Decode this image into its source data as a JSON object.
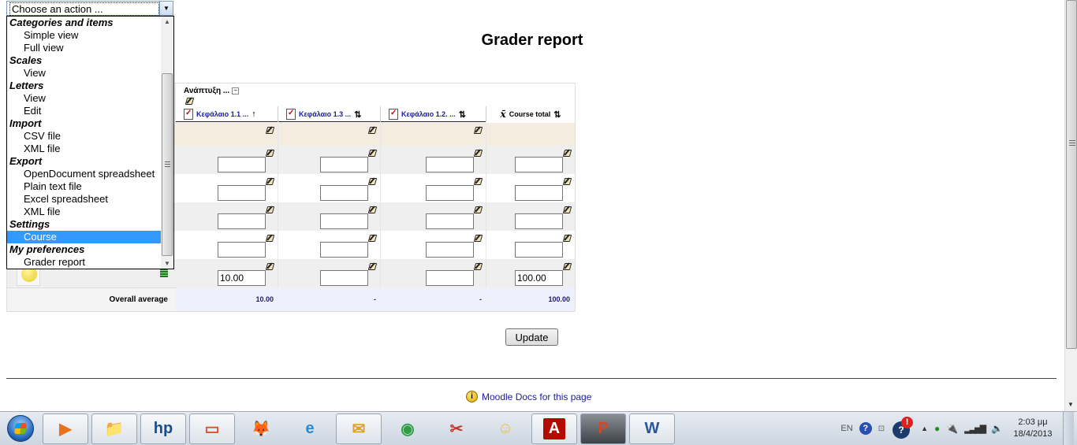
{
  "page": {
    "title": "Grader report",
    "update_label": "Update",
    "docs_link": "Moodle Docs for this page"
  },
  "action_select": {
    "value": "Choose an action ...",
    "options": [
      {
        "type": "group",
        "label": "Categories and items"
      },
      {
        "type": "option",
        "label": "Simple view"
      },
      {
        "type": "option",
        "label": "Full view"
      },
      {
        "type": "group",
        "label": "Scales"
      },
      {
        "type": "option",
        "label": "View"
      },
      {
        "type": "group",
        "label": "Letters"
      },
      {
        "type": "option",
        "label": "View"
      },
      {
        "type": "option",
        "label": "Edit"
      },
      {
        "type": "group",
        "label": "Import"
      },
      {
        "type": "option",
        "label": "CSV file"
      },
      {
        "type": "option",
        "label": "XML file"
      },
      {
        "type": "group",
        "label": "Export"
      },
      {
        "type": "option",
        "label": "OpenDocument spreadsheet"
      },
      {
        "type": "option",
        "label": "Plain text file"
      },
      {
        "type": "option",
        "label": "Excel spreadsheet"
      },
      {
        "type": "option",
        "label": "XML file"
      },
      {
        "type": "group",
        "label": "Settings"
      },
      {
        "type": "option",
        "label": "Course",
        "selected": true
      },
      {
        "type": "group",
        "label": "My preferences"
      },
      {
        "type": "option",
        "label": "Grader report"
      }
    ]
  },
  "grader": {
    "category_label": "Ανάπτυξη ...",
    "collapse_symbol": "−",
    "columns": [
      {
        "label": "Κεφάλαιο 1.1 ...",
        "sort": "↑",
        "icon": "assignment-icon"
      },
      {
        "label": "Κεφάλαιο 1.3 ...",
        "sort": "⇅",
        "icon": "assignment-icon"
      },
      {
        "label": "Κεφάλαιο 1.2. ...",
        "sort": "⇅",
        "icon": "assignment-icon"
      },
      {
        "label": "Course total",
        "sort": "⇅",
        "icon": "mean-icon"
      }
    ],
    "mean_symbol": "x̄",
    "rows": [
      {
        "values": [
          "",
          "",
          "",
          ""
        ]
      },
      {
        "values": [
          "",
          "",
          "",
          ""
        ]
      },
      {
        "values": [
          "",
          "",
          "",
          ""
        ]
      },
      {
        "values": [
          "",
          "",
          "",
          ""
        ]
      },
      {
        "values": [
          "10.00",
          "",
          "",
          "100.00"
        ]
      }
    ],
    "overall_average": {
      "label": "Overall average",
      "values": [
        "10.00",
        "-",
        "-",
        "100.00"
      ]
    }
  },
  "taskbar": {
    "apps": [
      "media-player-icon",
      "explorer-icon",
      "hp-icon",
      "app-icon",
      "firefox-icon",
      "ie-icon",
      "outlook-icon",
      "chrome-icon",
      "snipping-tool-icon",
      "messenger-icon",
      "acrobat-icon",
      "powerpoint-icon",
      "word-icon"
    ],
    "language": "EN",
    "time": "2:03 μμ",
    "date": "18/4/2013"
  }
}
